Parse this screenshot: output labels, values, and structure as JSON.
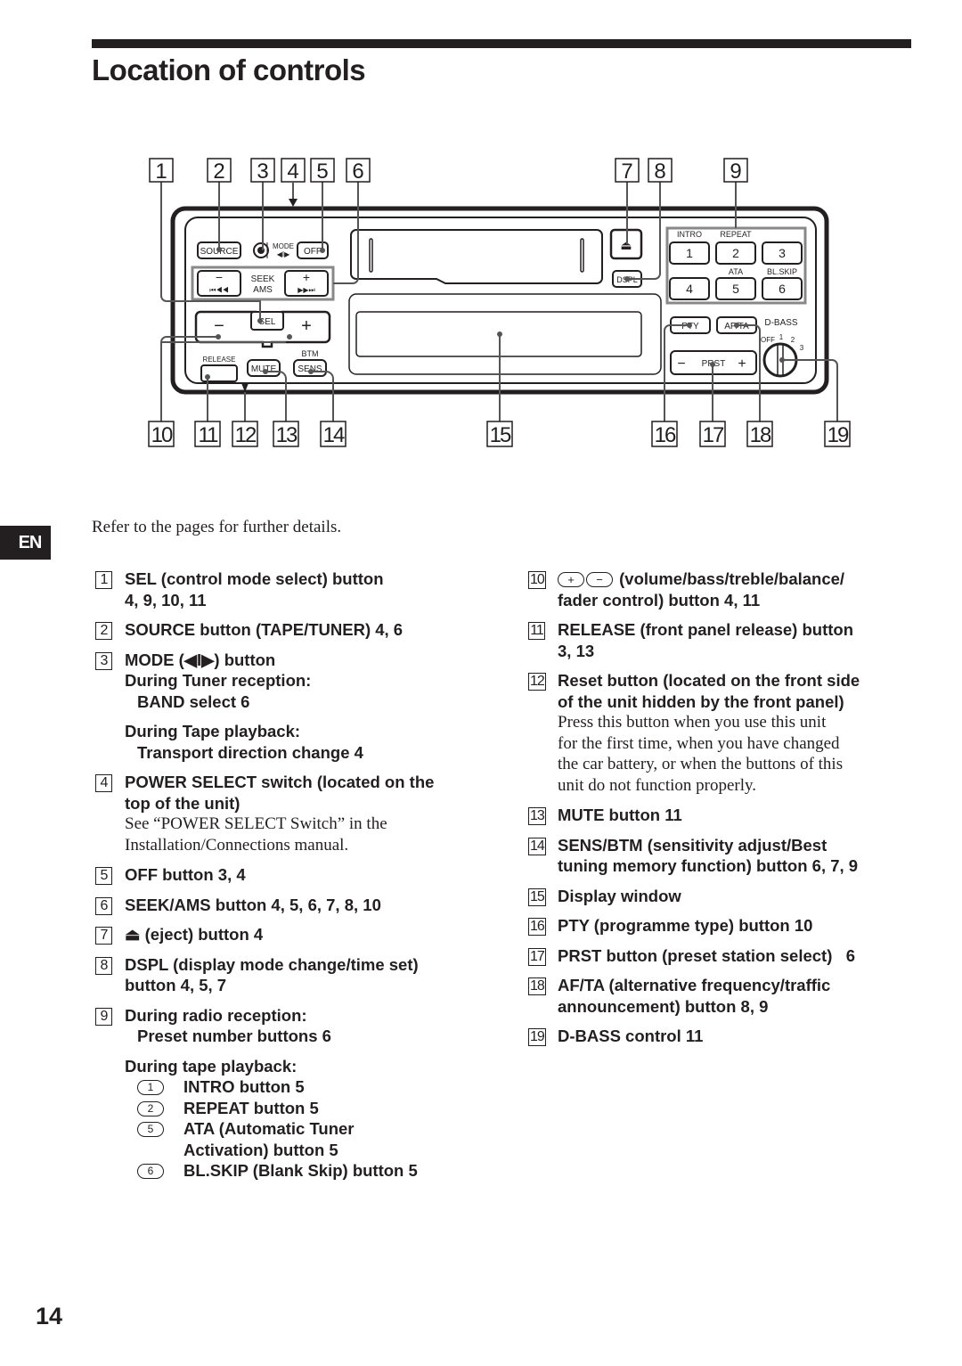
{
  "page": {
    "title": "Location of controls",
    "language_tab": "EN",
    "intro": "Refer to the pages for further details.",
    "page_number": "14"
  },
  "diagram": {
    "callouts_top": [
      "1",
      "2",
      "3",
      "4",
      "5",
      "6",
      "7",
      "8",
      "9"
    ],
    "callouts_bottom": [
      "10",
      "11",
      "12",
      "13",
      "14",
      "15",
      "16",
      "17",
      "18",
      "19"
    ],
    "labels": {
      "source": "SOURCE",
      "mode": "MODE",
      "off": "OFF",
      "seek": "SEEK",
      "ams": "AMS",
      "minus": "−",
      "plus": "+",
      "sel": "SEL",
      "release": "RELEASE",
      "mute": "MUTE",
      "btm": "BTM",
      "sens": "SENS",
      "dspl": "DSPL",
      "intro": "INTRO",
      "repeat": "REPEAT",
      "ata": "ATA",
      "blskip": "BL.SKIP",
      "presets": [
        "1",
        "2",
        "3",
        "4",
        "5",
        "6"
      ],
      "pty": "PTY",
      "afta": "AF/TA",
      "dbass": "D-BASS",
      "dbass_off": "OFF",
      "dbass_levels": [
        "1",
        "2",
        "3"
      ],
      "prst": "PRST"
    },
    "icons": {
      "eject": "⏏",
      "seek_back": "⏮◀◀",
      "seek_fwd": "▶▶⏭",
      "mode_arrows": "◀I▶"
    }
  },
  "left_items": [
    {
      "num": "1",
      "lines": [
        "SEL (control mode select) button",
        "4, 9, 10, 11"
      ]
    },
    {
      "num": "2",
      "lines": [
        "SOURCE button (TAPE/TUNER) 4, 6"
      ]
    },
    {
      "num": "3",
      "title": "MODE (◀I▶) button",
      "sub1_head": "During Tuner reception:",
      "sub1_body": "BAND select 6",
      "sub2_head": "During Tape playback:",
      "sub2_body": "Transport direction change 4"
    },
    {
      "num": "4",
      "lines": [
        "POWER SELECT switch (located on the",
        "top of the unit)"
      ],
      "note": [
        "See “POWER SELECT Switch” in the",
        "Installation/Connections manual."
      ]
    },
    {
      "num": "5",
      "lines": [
        "OFF button 3, 4"
      ]
    },
    {
      "num": "6",
      "lines": [
        "SEEK/AMS button 4, 5, 6, 7, 8, 10"
      ]
    },
    {
      "num": "7",
      "lines": [
        "⏏ (eject) button 4"
      ]
    },
    {
      "num": "8",
      "lines": [
        "DSPL (display mode change/time set)",
        "button 4, 5, 7"
      ]
    },
    {
      "num": "9",
      "sub1_head": "During radio reception:",
      "sub1_body": "Preset number buttons 6",
      "sub2_head": "During tape playback:",
      "tape_buttons": [
        {
          "key": "1",
          "lines": [
            "INTRO button 5"
          ]
        },
        {
          "key": "2",
          "lines": [
            "REPEAT button 5"
          ]
        },
        {
          "key": "5",
          "lines": [
            "ATA (Automatic Tuner",
            "Activation) button 5"
          ]
        },
        {
          "key": "6",
          "lines": [
            "BL.SKIP (Blank Skip) button 5"
          ]
        }
      ]
    }
  ],
  "right_items": [
    {
      "num": "10",
      "plus": "+",
      "minus": "−",
      "lines": [
        "(volume/bass/treble/balance/",
        "fader control) button 4, 11"
      ]
    },
    {
      "num": "11",
      "lines": [
        "RELEASE (front panel release) button",
        "3, 13"
      ]
    },
    {
      "num": "12",
      "lines": [
        "Reset button (located on the front side",
        "of the unit hidden by the front panel)"
      ],
      "note": [
        "Press this button when you use this unit",
        "for the first time, when you have changed",
        "the car battery, or when the buttons of this",
        "unit do not function properly."
      ]
    },
    {
      "num": "13",
      "lines": [
        "MUTE button 11"
      ]
    },
    {
      "num": "14",
      "lines": [
        "SENS/BTM (sensitivity adjust/Best",
        "tuning memory function) button 6, 7, 9"
      ]
    },
    {
      "num": "15",
      "lines": [
        "Display window"
      ]
    },
    {
      "num": "16",
      "lines": [
        "PTY (programme type) button 10"
      ]
    },
    {
      "num": "17",
      "lines": [
        "PRST button (preset station select)   6"
      ]
    },
    {
      "num": "18",
      "lines": [
        "AF/TA (alternative frequency/traffic",
        "announcement) button 8, 9"
      ]
    },
    {
      "num": "19",
      "lines": [
        "D-BASS control 11"
      ]
    }
  ]
}
